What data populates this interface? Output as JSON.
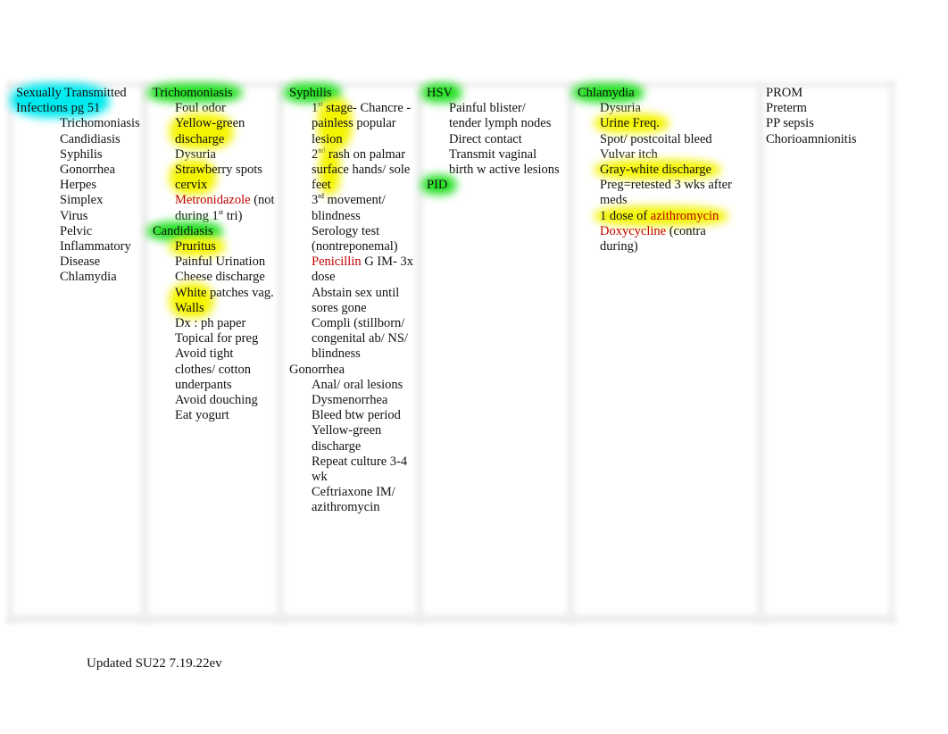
{
  "footer": "Updated SU22 7.19.22ev",
  "bullet_glyph": "",
  "columns": [
    {
      "heading": "Sexually Transmitted Infections pg 51",
      "heading_highlight": "cyan",
      "items": [
        "Trichomoniasis",
        "Candidiasis",
        "Syphilis",
        "Gonorrhea",
        "Herpes Simplex Virus",
        "Pelvic Inflammatory Disease",
        "Chlamydia"
      ]
    },
    {
      "sections": [
        {
          "heading": "Trichomoniasis",
          "heading_highlight": "green",
          "items": [
            {
              "text": "Foul odor"
            },
            {
              "text": "Yellow-green discharge",
              "highlight": "yellow"
            },
            {
              "text": "Dysuria"
            },
            {
              "text": "Strawberry spots cervix",
              "highlight": "yellow"
            },
            {
              "text": "Metronidazole",
              "color": "red",
              "suffix": " (not during 1",
              "sup": "st",
              "suffix2": " tri)"
            }
          ]
        },
        {
          "heading": "Candidiasis",
          "heading_highlight": "green",
          "items": [
            {
              "text": "Pruritus",
              "highlight": "yellow"
            },
            {
              "text": "Painful Urination"
            },
            {
              "text": "Cheese discharge"
            },
            {
              "text": "White patches vag. Walls",
              "highlight": "yellow"
            },
            {
              "text": "Dx : ph paper"
            },
            {
              "text": "Topical for preg"
            },
            {
              "text": "Avoid tight clothes/ cotton underpants"
            },
            {
              "text": "Avoid douching"
            },
            {
              "text": "Eat yogurt"
            }
          ]
        }
      ]
    },
    {
      "sections": [
        {
          "heading": "Syphilis",
          "heading_highlight": "green",
          "items": [
            {
              "prefix": "1",
              "sup": "st",
              "text": " stage- Chancre - painless popular lesion",
              "highlight": "yellow"
            },
            {
              "prefix": "2",
              "sup": "nd",
              "text": " rash on palmar surface hands/ sole feet",
              "highlight": "yellow"
            },
            {
              "prefix": "3",
              "sup": "rd",
              "text": " movement/ blindness"
            },
            {
              "text": "Serology test (nontreponemal)"
            },
            {
              "text": "Penicillin",
              "color": "red",
              "suffix": " G IM- 3x dose"
            },
            {
              "text": "Abstain sex until sores gone"
            },
            {
              "text": "Compli (stillborn/ congenital ab/ NS/ blindness"
            }
          ]
        },
        {
          "heading": "Gonorrhea",
          "heading_highlight": "none",
          "items": [
            {
              "text": "Anal/ oral lesions"
            },
            {
              "text": "Dysmenorrhea"
            },
            {
              "text": "Bleed btw period"
            },
            {
              "text": "Yellow-green discharge"
            },
            {
              "text": "Repeat culture 3-4 wk"
            },
            {
              "text": "Ceftriaxone IM/ azithromycin"
            }
          ]
        }
      ]
    },
    {
      "sections": [
        {
          "heading": "HSV",
          "heading_highlight": "green",
          "items": [
            {
              "text": "Painful blister/ tender lymph nodes"
            },
            {
              "text": "Direct contact"
            },
            {
              "text": "Transmit vaginal birth w active lesions"
            }
          ]
        },
        {
          "heading": "PID",
          "heading_highlight": "green",
          "items": []
        }
      ]
    },
    {
      "sections": [
        {
          "heading": "Chlamydia",
          "heading_highlight": "green",
          "items": [
            {
              "text": "Dysuria"
            },
            {
              "text": "Urine Freq.",
              "highlight": "yellow"
            },
            {
              "text": "Spot/ postcoital bleed"
            },
            {
              "text": "Vulvar itch"
            },
            {
              "text": "Gray-white discharge",
              "highlight": "yellow"
            },
            {
              "text": "Preg=retested 3 wks after meds"
            },
            {
              "text": "1 dose of ",
              "suffix_red": "azithromycin",
              "highlight": "yellow"
            },
            {
              "text": "Doxycycline",
              "color": "red",
              "suffix": " (contra during)"
            }
          ]
        }
      ]
    },
    {
      "lines": [
        "PROM",
        "Preterm",
        "PP sepsis",
        "Chorioamnionitis"
      ]
    }
  ]
}
